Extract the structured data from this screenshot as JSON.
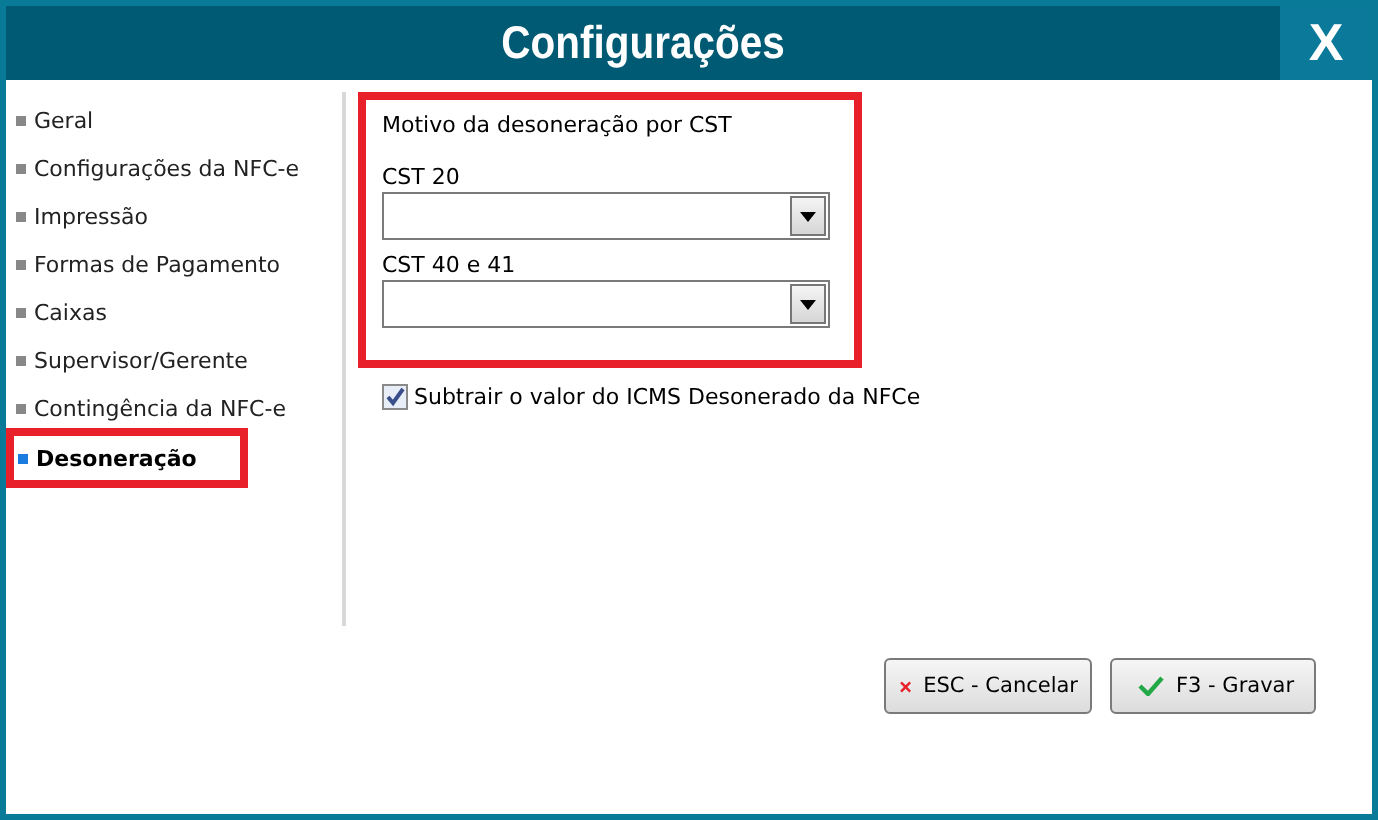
{
  "window": {
    "title": "Configurações",
    "close": "X"
  },
  "sidebar": {
    "items": [
      {
        "label": "Geral",
        "selected": false,
        "highlighted": false
      },
      {
        "label": "Configurações da NFC-e",
        "selected": false,
        "highlighted": false
      },
      {
        "label": "Impressão",
        "selected": false,
        "highlighted": false
      },
      {
        "label": "Formas de Pagamento",
        "selected": false,
        "highlighted": false
      },
      {
        "label": "Caixas",
        "selected": false,
        "highlighted": false
      },
      {
        "label": "Supervisor/Gerente",
        "selected": false,
        "highlighted": false
      },
      {
        "label": "Contingência da NFC-e",
        "selected": false,
        "highlighted": false
      },
      {
        "label": "Desoneração",
        "selected": true,
        "highlighted": true
      }
    ]
  },
  "section": {
    "title": "Motivo da desoneração por CST",
    "highlighted": true,
    "fields": [
      {
        "label": "CST 20"
      },
      {
        "label": "CST 40 e 41"
      }
    ]
  },
  "checkbox": {
    "label": "Subtrair o valor do ICMS Desonerado da NFCe",
    "checked": true
  },
  "buttons": [
    {
      "kind": "cancel",
      "label": "ESC - Cancelar"
    },
    {
      "kind": "save",
      "label": "F3 - Gravar"
    }
  ]
}
